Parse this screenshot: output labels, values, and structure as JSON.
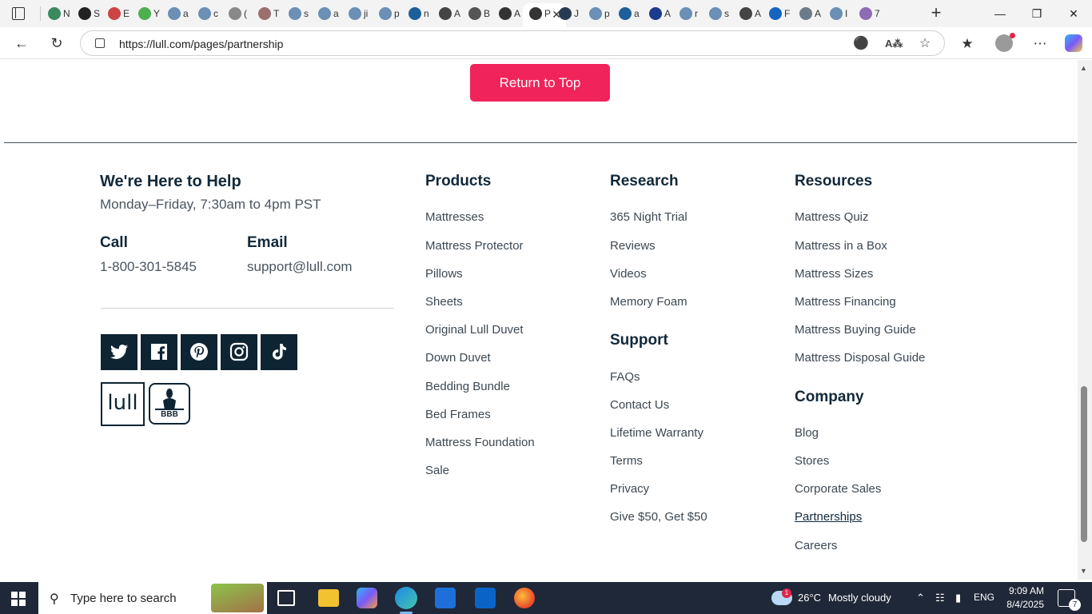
{
  "browser": {
    "url": "https://lull.com/pages/partnership",
    "tabs": [
      {
        "char": "N",
        "color": "#3b8a5e"
      },
      {
        "char": "S",
        "color": "#222222"
      },
      {
        "char": "E",
        "color": "#c44"
      },
      {
        "char": "Y",
        "color": "#4caf50"
      },
      {
        "char": "a",
        "color": "#6b8fb5"
      },
      {
        "char": "c",
        "color": "#6b8fb5"
      },
      {
        "char": "(",
        "color": "#888888"
      },
      {
        "char": "T",
        "color": "#9c6f6f"
      },
      {
        "char": "s",
        "color": "#6b8fb5"
      },
      {
        "char": "a",
        "color": "#6b8fb5"
      },
      {
        "char": "ji",
        "color": "#6b8fb5"
      },
      {
        "char": "p",
        "color": "#6b8fb5"
      },
      {
        "char": "n",
        "color": "#1d5f9a"
      },
      {
        "char": "A",
        "color": "#444444"
      },
      {
        "char": "B",
        "color": "#555555"
      },
      {
        "char": "A",
        "color": "#333333"
      },
      {
        "char": "P",
        "color": "#333333"
      },
      {
        "char": "J",
        "color": "#263b52"
      },
      {
        "char": "p",
        "color": "#6b8fb5"
      },
      {
        "char": "a",
        "color": "#1d5f9a"
      },
      {
        "char": "A",
        "color": "#1a3c8a"
      },
      {
        "char": "r",
        "color": "#6b8fb5"
      },
      {
        "char": "s",
        "color": "#6b8fb5"
      },
      {
        "char": "A",
        "color": "#444444"
      },
      {
        "char": "F",
        "color": "#1565c0"
      },
      {
        "char": "A",
        "color": "#6b7b8a"
      },
      {
        "char": "I",
        "color": "#6b8fb5"
      },
      {
        "char": "7",
        "color": "#8e6bb5"
      }
    ],
    "active_tab_index": 16
  },
  "page": {
    "return_to_top": "Return to Top",
    "help": {
      "title": "We're Here to Help",
      "hours": "Monday–Friday, 7:30am to 4pm PST",
      "call_label": "Call",
      "call_number": "1-800-301-5845",
      "email_label": "Email",
      "email_value": "support@lull.com"
    },
    "social": [
      "twitter-icon",
      "facebook-icon",
      "pinterest-icon",
      "instagram-icon",
      "tiktok-icon"
    ],
    "logos": {
      "lull": "lull",
      "bbb": "BBB"
    },
    "columns": {
      "products": {
        "title": "Products",
        "links": [
          "Mattresses",
          "Mattress Protector",
          "Pillows",
          "Sheets",
          "Original Lull Duvet",
          "Down Duvet",
          "Bedding Bundle",
          "Bed Frames",
          "Mattress Foundation",
          "Sale"
        ]
      },
      "research": {
        "title": "Research",
        "links": [
          "365 Night Trial",
          "Reviews",
          "Videos",
          "Memory Foam"
        ]
      },
      "support": {
        "title": "Support",
        "links": [
          "FAQs",
          "Contact Us",
          "Lifetime Warranty",
          "Terms",
          "Privacy",
          "Give $50, Get $50"
        ]
      },
      "resources": {
        "title": "Resources",
        "links": [
          "Mattress Quiz",
          "Mattress in a Box",
          "Mattress Sizes",
          "Mattress Financing",
          "Mattress Buying Guide",
          "Mattress Disposal Guide"
        ]
      },
      "company": {
        "title": "Company",
        "links": [
          "Blog",
          "Stores",
          "Corporate Sales",
          "Partnerships",
          "Careers"
        ]
      }
    }
  },
  "taskbar": {
    "search_placeholder": "Type here to search",
    "weather_temp": "26°C",
    "weather_desc": "Mostly cloudy",
    "weather_badge": "1",
    "language": "ENG",
    "time": "9:09 AM",
    "date": "8/4/2025",
    "notification_count": "7"
  },
  "colors": {
    "accent": "#f0245a",
    "navy": "#0f2433"
  }
}
